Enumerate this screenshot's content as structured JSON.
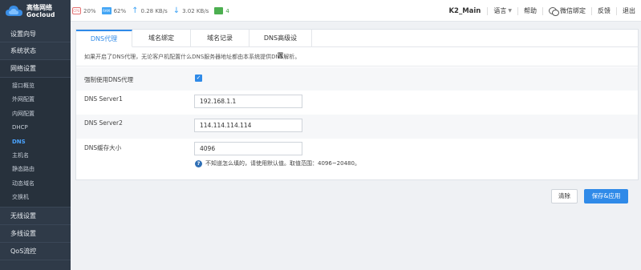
{
  "brand": {
    "name_cn": "高恪网络",
    "name_en": "Gocloud"
  },
  "stats": {
    "cpu": "20%",
    "ram": "62%",
    "upload": "0.28 KB/s",
    "download": "3.02 KB/s",
    "devices": "4"
  },
  "topbar": {
    "device_name": "K2_Main",
    "language": "语言",
    "help": "帮助",
    "wechat_bind": "微信绑定",
    "feedback": "反馈",
    "logout": "退出"
  },
  "sidebar": {
    "items": [
      {
        "label": "设置向导"
      },
      {
        "label": "系统状态"
      },
      {
        "label": "网络设置"
      }
    ],
    "sub_items": [
      {
        "label": "接口概览"
      },
      {
        "label": "外网配置"
      },
      {
        "label": "内网配置"
      },
      {
        "label": "DHCP"
      },
      {
        "label": "DNS"
      },
      {
        "label": "主机名"
      },
      {
        "label": "静态路由"
      },
      {
        "label": "动态域名"
      },
      {
        "label": "交换机"
      }
    ],
    "bottom_items": [
      {
        "label": "无线设置"
      },
      {
        "label": "多线设置"
      },
      {
        "label": "QoS流控"
      }
    ]
  },
  "tabs": [
    {
      "label": "DNS代理"
    },
    {
      "label": "域名绑定"
    },
    {
      "label": "域名记录"
    },
    {
      "label": "DNS高级设置"
    }
  ],
  "notice": "如果开启了DNS代理，无论客户机配置什么DNS服务器地址都由本系统提供DNS解析。",
  "form": {
    "force_proxy_label": "强制使用DNS代理",
    "force_proxy_checked": true,
    "dns1_label": "DNS Server1",
    "dns1_value": "192.168.1.1",
    "dns2_label": "DNS Server2",
    "dns2_value": "114.114.114.114",
    "cache_label": "DNS缓存大小",
    "cache_value": "4096",
    "cache_hint": "不知道怎么填的，请使用默认值。取值范围：4096~20480。"
  },
  "buttons": {
    "clear": "清除",
    "save": "保存&应用"
  },
  "colors": {
    "accent": "#2f8ae8",
    "sidebar_bg": "#2f3a48",
    "active_nav": "#4aa3ff"
  }
}
